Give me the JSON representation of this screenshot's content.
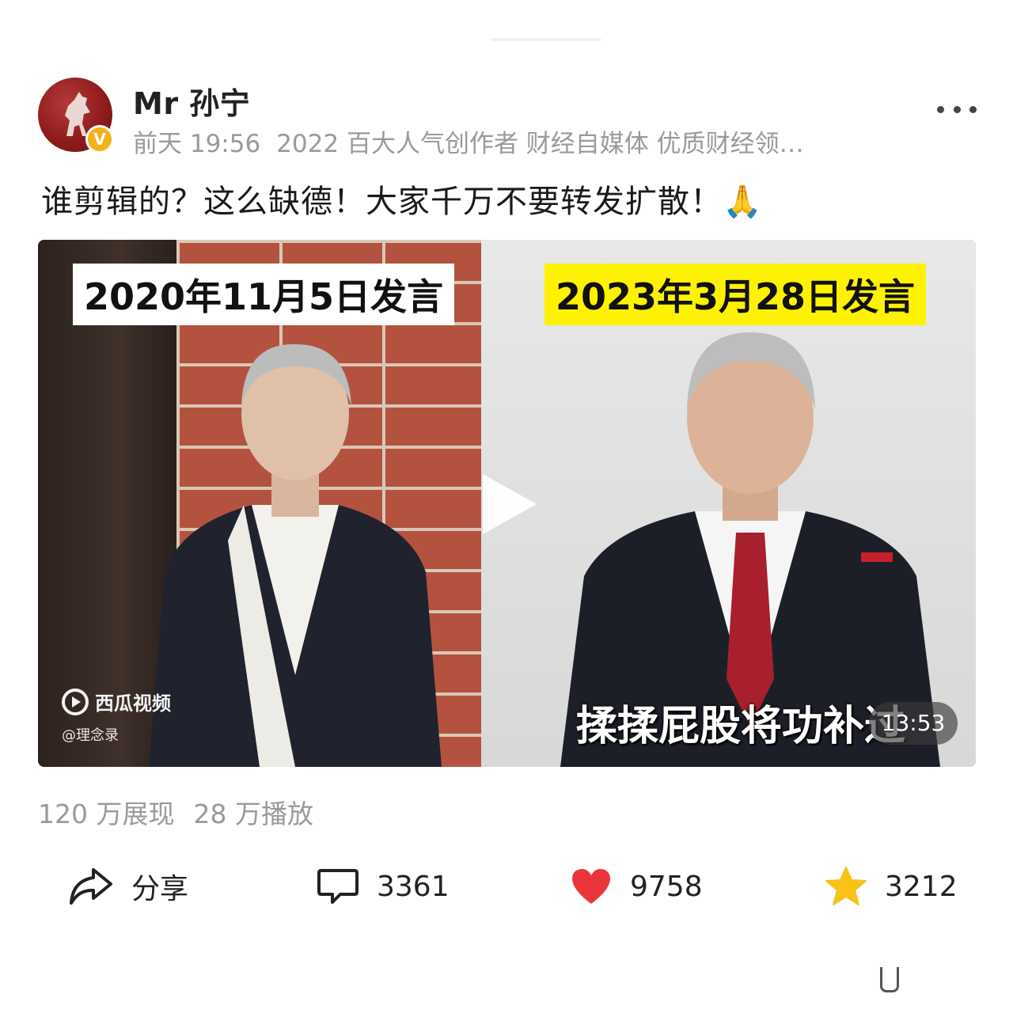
{
  "author": {
    "name": "Mr 孙宁",
    "time": "前天 19:56",
    "description": "2022 百大人气创作者 财经自媒体 优质财经领…",
    "verified_badge": "V"
  },
  "post": {
    "text": "谁剪辑的？这么缺德！大家千万不要转发扩散！🙏"
  },
  "video": {
    "left_caption": "2020年11月5日发言",
    "right_caption": "2023年3月28日发言",
    "watermark_logo": "西瓜视频",
    "watermark_handle": "@理念录",
    "subtitle": "揉揉屁股将功补过",
    "duration": "13:53"
  },
  "stats": {
    "impressions": "120 万展现",
    "plays": "28 万播放"
  },
  "actions": {
    "share_label": "分享",
    "comment_count": "3361",
    "like_count": "9758",
    "favorite_count": "3212"
  },
  "colors": {
    "like": "#e8363a",
    "favorite": "#f8c21b",
    "badge": "#f3b21b",
    "caption_highlight": "#fff200"
  },
  "icons": [
    "more-icon",
    "play-icon",
    "share-icon",
    "comment-icon",
    "heart-icon",
    "star-icon",
    "verified-badge-icon"
  ]
}
